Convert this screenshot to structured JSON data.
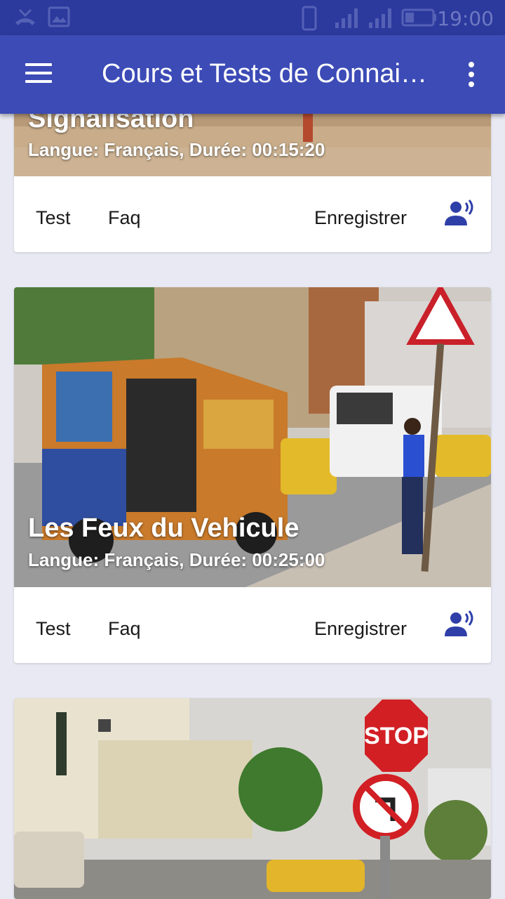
{
  "status_bar": {
    "time": "19:00"
  },
  "app_bar": {
    "title": "Cours et Tests de Connaissances"
  },
  "cards": [
    {
      "title": "Signalisation",
      "subtitle": "Langue: Français, Durée: 00:15:20",
      "actions": {
        "test": "Test",
        "faq": "Faq",
        "record": "Enregistrer"
      }
    },
    {
      "title": "Les Feux du Vehicule",
      "subtitle": "Langue: Français, Durée: 00:25:00",
      "actions": {
        "test": "Test",
        "faq": "Faq",
        "record": "Enregistrer"
      }
    },
    {
      "title": "",
      "subtitle": ""
    }
  ],
  "colors": {
    "primary": "#3c4bb6",
    "status": "#2c3a9e",
    "accent_icon": "#2f3fa8",
    "background": "#e8e9f3"
  },
  "icons": {
    "menu": "hamburger-icon",
    "overflow": "more-vert-icon",
    "record": "record-voice-icon"
  }
}
